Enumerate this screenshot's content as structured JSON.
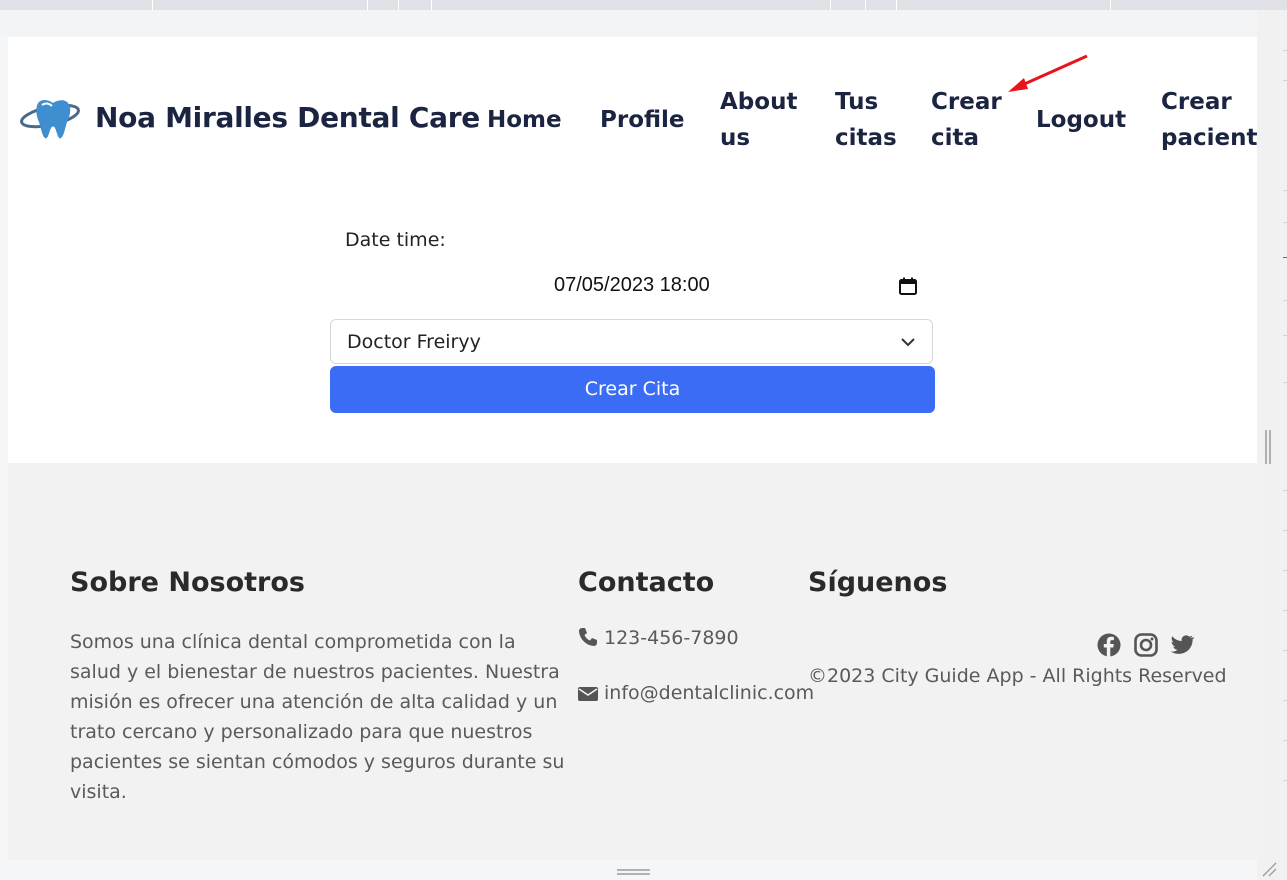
{
  "header": {
    "brand": "Noa Miralles Dental Care",
    "logo_icon": "tooth-logo-icon",
    "nav": [
      {
        "line1": "Home",
        "line2": ""
      },
      {
        "line1": "Profile",
        "line2": ""
      },
      {
        "line1": "About",
        "line2": "us"
      },
      {
        "line1": "Tus",
        "line2": "citas"
      },
      {
        "line1": "Crear",
        "line2": "cita"
      },
      {
        "line1": "Logout",
        "line2": ""
      },
      {
        "line1": "Crear",
        "line2": "paciente"
      }
    ]
  },
  "form": {
    "datetime_label": "Date time:",
    "datetime_value": "07/05/2023 18:00",
    "doctor_selected": "Doctor Freiryy",
    "submit_label": "Crear Cita"
  },
  "footer": {
    "about_title": "Sobre Nosotros",
    "about_text": "Somos una clínica dental comprometida con la salud y el bienestar de nuestros pacientes. Nuestra misión es ofrecer una atención de alta calidad y un trato cercano y personalizado para que nuestros pacientes se sientan cómodos y seguros durante su visita.",
    "contact_title": "Contacto",
    "phone": "123-456-7890",
    "email": "info@dentalclinic.com",
    "follow_title": "Síguenos",
    "social_icons": [
      "facebook-icon",
      "instagram-icon",
      "twitter-icon"
    ],
    "copyright": "©2023 City Guide App - All Rights Reserved"
  },
  "colors": {
    "primary_button": "#3b6cf6",
    "nav_text": "#1b2440",
    "footer_bg": "#f2f2f2",
    "annotation": "#e8141c"
  }
}
